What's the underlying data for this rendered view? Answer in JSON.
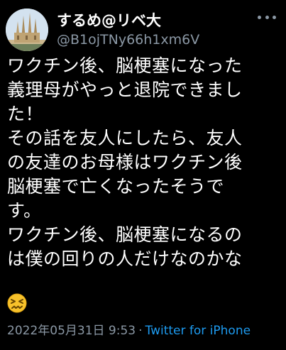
{
  "author": {
    "display_name": "するめ@リベ大",
    "handle": "@B1ojTNy66h1xm6V",
    "avatar": "church-photo-avatar"
  },
  "more_button": "more-options-icon",
  "tweet": {
    "text": "ワクチン後、脳梗塞になった\n義理母がやっと退院できまし\nた！\nその話を友人にしたら、友人\nの友達のお母様はワクチン後\n脳梗塞で亡くなったそうで\nす。\nワクチン後、脳梗塞になるの\nは僕の回りの人だけなのかな",
    "emoji": "confounded-face-emoji"
  },
  "meta": {
    "timestamp": "2022年05月31日 9:53",
    "separator": "·",
    "source": "Twitter for iPhone"
  },
  "colors": {
    "background": "#000000",
    "text": "#ffffff",
    "secondary": "#8b98a5",
    "link": "#1d9bf0"
  }
}
